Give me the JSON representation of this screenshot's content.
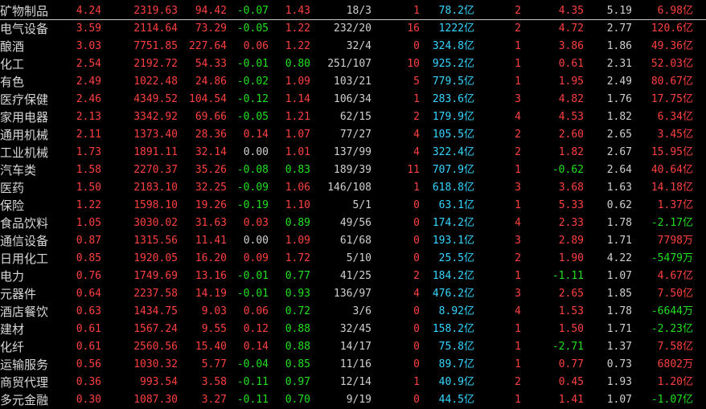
{
  "units": {
    "yi": "亿",
    "wan": "万"
  },
  "rows": [
    {
      "name": "矿物制品",
      "pct": "4.24",
      "price": "2319.63",
      "change": "94.42",
      "speed": "-0.07",
      "vol_ratio": "1.43",
      "updown": "18/3",
      "lead": "1",
      "amount": "78.2",
      "amount_unit": "亿",
      "days": "2",
      "d3": "4.35",
      "turnover": "5.19",
      "flow": "6.98",
      "flow_unit": "亿"
    },
    {
      "name": "电气设备",
      "pct": "3.59",
      "price": "2114.64",
      "change": "73.29",
      "speed": "-0.05",
      "vol_ratio": "1.22",
      "updown": "232/20",
      "lead": "16",
      "amount": "1222",
      "amount_unit": "亿",
      "days": "2",
      "d3": "4.72",
      "turnover": "2.77",
      "flow": "120.6",
      "flow_unit": "亿"
    },
    {
      "name": "酿酒",
      "pct": "3.03",
      "price": "7751.85",
      "change": "227.64",
      "speed": "0.06",
      "vol_ratio": "1.22",
      "updown": "32/4",
      "lead": "0",
      "amount": "324.8",
      "amount_unit": "亿",
      "days": "1",
      "d3": "3.86",
      "turnover": "1.86",
      "flow": "49.36",
      "flow_unit": "亿"
    },
    {
      "name": "化工",
      "pct": "2.54",
      "price": "2192.72",
      "change": "54.33",
      "speed": "-0.01",
      "vol_ratio": "0.80",
      "updown": "251/107",
      "lead": "10",
      "amount": "925.2",
      "amount_unit": "亿",
      "days": "1",
      "d3": "0.61",
      "turnover": "2.31",
      "flow": "52.03",
      "flow_unit": "亿"
    },
    {
      "name": "有色",
      "pct": "2.49",
      "price": "1022.48",
      "change": "24.86",
      "speed": "-0.02",
      "vol_ratio": "1.09",
      "updown": "103/21",
      "lead": "5",
      "amount": "779.5",
      "amount_unit": "亿",
      "days": "1",
      "d3": "1.95",
      "turnover": "2.49",
      "flow": "80.67",
      "flow_unit": "亿"
    },
    {
      "name": "医疗保健",
      "pct": "2.46",
      "price": "4349.52",
      "change": "104.54",
      "speed": "-0.12",
      "vol_ratio": "1.14",
      "updown": "106/34",
      "lead": "1",
      "amount": "283.6",
      "amount_unit": "亿",
      "days": "3",
      "d3": "4.82",
      "turnover": "1.76",
      "flow": "17.75",
      "flow_unit": "亿"
    },
    {
      "name": "家用电器",
      "pct": "2.13",
      "price": "3342.92",
      "change": "69.66",
      "speed": "-0.05",
      "vol_ratio": "1.21",
      "updown": "62/15",
      "lead": "2",
      "amount": "179.9",
      "amount_unit": "亿",
      "days": "4",
      "d3": "4.53",
      "turnover": "1.82",
      "flow": "6.34",
      "flow_unit": "亿"
    },
    {
      "name": "通用机械",
      "pct": "2.11",
      "price": "1373.40",
      "change": "28.36",
      "speed": "0.14",
      "vol_ratio": "1.07",
      "updown": "77/27",
      "lead": "4",
      "amount": "105.5",
      "amount_unit": "亿",
      "days": "2",
      "d3": "2.60",
      "turnover": "2.65",
      "flow": "3.45",
      "flow_unit": "亿"
    },
    {
      "name": "工业机械",
      "pct": "1.73",
      "price": "1891.11",
      "change": "32.14",
      "speed": "0.00",
      "vol_ratio": "1.01",
      "updown": "137/99",
      "lead": "4",
      "amount": "322.4",
      "amount_unit": "亿",
      "days": "2",
      "d3": "1.82",
      "turnover": "2.67",
      "flow": "15.95",
      "flow_unit": "亿"
    },
    {
      "name": "汽车类",
      "pct": "1.58",
      "price": "2270.37",
      "change": "35.26",
      "speed": "-0.08",
      "vol_ratio": "0.83",
      "updown": "189/39",
      "lead": "11",
      "amount": "707.9",
      "amount_unit": "亿",
      "days": "1",
      "d3": "-0.62",
      "turnover": "2.64",
      "flow": "40.64",
      "flow_unit": "亿"
    },
    {
      "name": "医药",
      "pct": "1.50",
      "price": "2183.10",
      "change": "32.25",
      "speed": "-0.09",
      "vol_ratio": "1.06",
      "updown": "146/108",
      "lead": "1",
      "amount": "618.8",
      "amount_unit": "亿",
      "days": "3",
      "d3": "3.68",
      "turnover": "1.63",
      "flow": "14.18",
      "flow_unit": "亿"
    },
    {
      "name": "保险",
      "pct": "1.22",
      "price": "1598.10",
      "change": "19.26",
      "speed": "-0.19",
      "vol_ratio": "1.10",
      "updown": "5/1",
      "lead": "0",
      "amount": "63.1",
      "amount_unit": "亿",
      "days": "1",
      "d3": "5.33",
      "turnover": "0.62",
      "flow": "1.37",
      "flow_unit": "亿"
    },
    {
      "name": "食品饮料",
      "pct": "1.05",
      "price": "3030.02",
      "change": "31.63",
      "speed": "0.03",
      "vol_ratio": "0.89",
      "updown": "49/56",
      "lead": "0",
      "amount": "174.2",
      "amount_unit": "亿",
      "days": "4",
      "d3": "2.33",
      "turnover": "1.78",
      "flow": "-2.17",
      "flow_unit": "亿"
    },
    {
      "name": "通信设备",
      "pct": "0.87",
      "price": "1315.56",
      "change": "11.41",
      "speed": "0.00",
      "vol_ratio": "1.09",
      "updown": "61/68",
      "lead": "0",
      "amount": "193.1",
      "amount_unit": "亿",
      "days": "3",
      "d3": "2.89",
      "turnover": "1.71",
      "flow": "7798",
      "flow_unit": "万"
    },
    {
      "name": "日用化工",
      "pct": "0.85",
      "price": "1920.05",
      "change": "16.20",
      "speed": "0.09",
      "vol_ratio": "1.72",
      "updown": "5/10",
      "lead": "0",
      "amount": "25.5",
      "amount_unit": "亿",
      "days": "2",
      "d3": "1.90",
      "turnover": "4.22",
      "flow": "-5479",
      "flow_unit": "万"
    },
    {
      "name": "电力",
      "pct": "0.76",
      "price": "1749.69",
      "change": "13.16",
      "speed": "-0.01",
      "vol_ratio": "0.77",
      "updown": "41/25",
      "lead": "2",
      "amount": "184.2",
      "amount_unit": "亿",
      "days": "1",
      "d3": "-1.11",
      "turnover": "1.07",
      "flow": "4.67",
      "flow_unit": "亿"
    },
    {
      "name": "元器件",
      "pct": "0.64",
      "price": "2237.58",
      "change": "14.19",
      "speed": "-0.01",
      "vol_ratio": "0.93",
      "updown": "136/97",
      "lead": "4",
      "amount": "476.2",
      "amount_unit": "亿",
      "days": "3",
      "d3": "2.65",
      "turnover": "1.85",
      "flow": "7.50",
      "flow_unit": "亿"
    },
    {
      "name": "酒店餐饮",
      "pct": "0.63",
      "price": "1434.75",
      "change": "9.03",
      "speed": "0.06",
      "vol_ratio": "0.72",
      "updown": "3/6",
      "lead": "0",
      "amount": "8.92",
      "amount_unit": "亿",
      "days": "4",
      "d3": "1.53",
      "turnover": "1.78",
      "flow": "-6644",
      "flow_unit": "万"
    },
    {
      "name": "建材",
      "pct": "0.61",
      "price": "1567.24",
      "change": "9.55",
      "speed": "0.12",
      "vol_ratio": "0.88",
      "updown": "32/45",
      "lead": "0",
      "amount": "158.2",
      "amount_unit": "亿",
      "days": "1",
      "d3": "1.50",
      "turnover": "1.71",
      "flow": "-2.23",
      "flow_unit": "亿"
    },
    {
      "name": "化纤",
      "pct": "0.61",
      "price": "2560.56",
      "change": "15.40",
      "speed": "0.14",
      "vol_ratio": "0.88",
      "updown": "14/17",
      "lead": "0",
      "amount": "75.8",
      "amount_unit": "亿",
      "days": "1",
      "d3": "-2.71",
      "turnover": "1.37",
      "flow": "7.58",
      "flow_unit": "亿"
    },
    {
      "name": "运输服务",
      "pct": "0.56",
      "price": "1030.32",
      "change": "5.77",
      "speed": "-0.04",
      "vol_ratio": "0.85",
      "updown": "11/16",
      "lead": "0",
      "amount": "89.7",
      "amount_unit": "亿",
      "days": "1",
      "d3": "0.77",
      "turnover": "0.73",
      "flow": "6802",
      "flow_unit": "万"
    },
    {
      "name": "商贸代理",
      "pct": "0.36",
      "price": "993.54",
      "change": "3.58",
      "speed": "-0.11",
      "vol_ratio": "0.97",
      "updown": "12/14",
      "lead": "1",
      "amount": "40.9",
      "amount_unit": "亿",
      "days": "2",
      "d3": "0.45",
      "turnover": "1.93",
      "flow": "1.20",
      "flow_unit": "亿"
    },
    {
      "name": "多元金融",
      "pct": "0.30",
      "price": "1087.30",
      "change": "3.27",
      "speed": "-0.11",
      "vol_ratio": "0.70",
      "updown": "9/19",
      "lead": "0",
      "amount": "44.5",
      "amount_unit": "亿",
      "days": "1",
      "d3": "1.41",
      "turnover": "1.07",
      "flow": "-1.07",
      "flow_unit": "亿"
    }
  ]
}
